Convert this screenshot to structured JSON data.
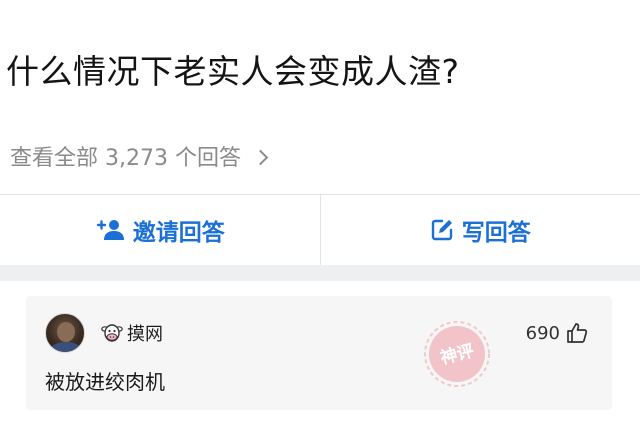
{
  "question": {
    "title": "什么情况下老实人会变成人渣?",
    "view_all": "查看全部 3,273 个回答"
  },
  "actions": {
    "invite_label": "邀请回答",
    "write_label": "写回答"
  },
  "comment": {
    "author": "摸网",
    "likes": "690",
    "text": "被放进绞肉机",
    "stamp_text": "神评"
  },
  "colors": {
    "accent": "#1b70d6",
    "muted": "#8a8a8a",
    "stamp": "#e8838f"
  },
  "icons": {
    "invite": "add-person-icon",
    "write": "edit-icon",
    "like": "thumbs-up-icon",
    "badge": "cow-icon",
    "view_all": "chevron-right-icon"
  }
}
